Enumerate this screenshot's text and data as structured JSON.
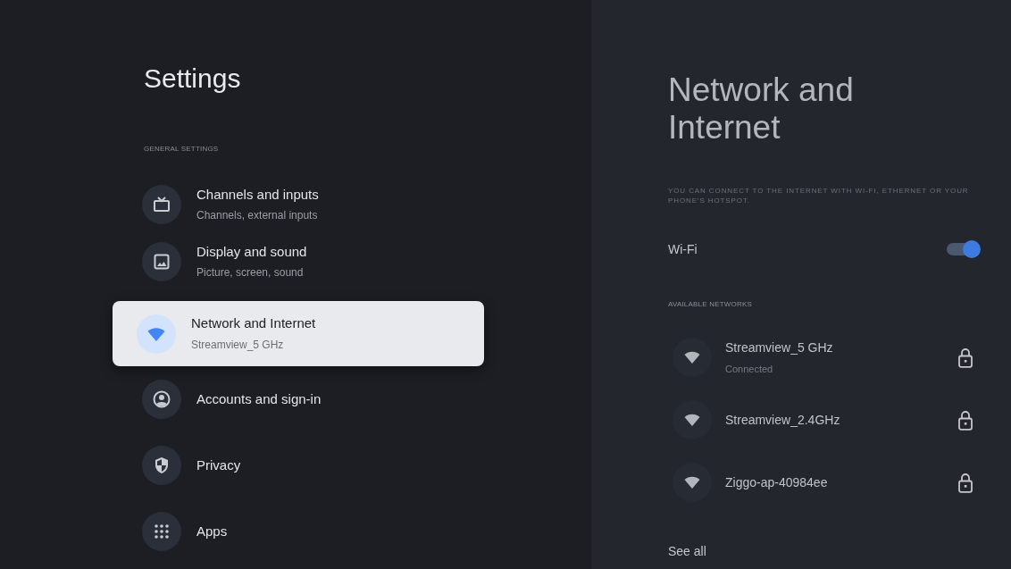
{
  "sidebar": {
    "title": "Settings",
    "section_label": "GENERAL SETTINGS",
    "items": [
      {
        "kind": "tv",
        "label": "Channels and inputs",
        "subtitle": "Channels, external inputs",
        "selected": false
      },
      {
        "kind": "image",
        "label": "Display and sound",
        "subtitle": "Picture, screen, sound",
        "selected": false
      },
      {
        "kind": "wifi",
        "label": "Network and Internet",
        "subtitle": "Streamview_5 GHz",
        "selected": true
      },
      {
        "kind": "account",
        "label": "Accounts and sign-in",
        "selected": false
      },
      {
        "kind": "shield",
        "label": "Privacy",
        "selected": false
      },
      {
        "kind": "apps",
        "label": "Apps",
        "selected": false
      }
    ]
  },
  "detail": {
    "title": "Network and Internet",
    "description": "YOU CAN CONNECT TO THE INTERNET WITH WI-FI, ETHERNET OR YOUR PHONE'S HOTSPOT.",
    "wifi": {
      "label": "Wi-Fi",
      "on": true
    },
    "section_label": "AVAILABLE NETWORKS",
    "networks": [
      {
        "name": "Streamview_5 GHz",
        "status": "Connected",
        "locked": true
      },
      {
        "name": "Streamview_2.4GHz",
        "locked": true
      },
      {
        "name": "Ziggo-ap-40984ee",
        "locked": true
      }
    ],
    "see_all": "See all"
  }
}
